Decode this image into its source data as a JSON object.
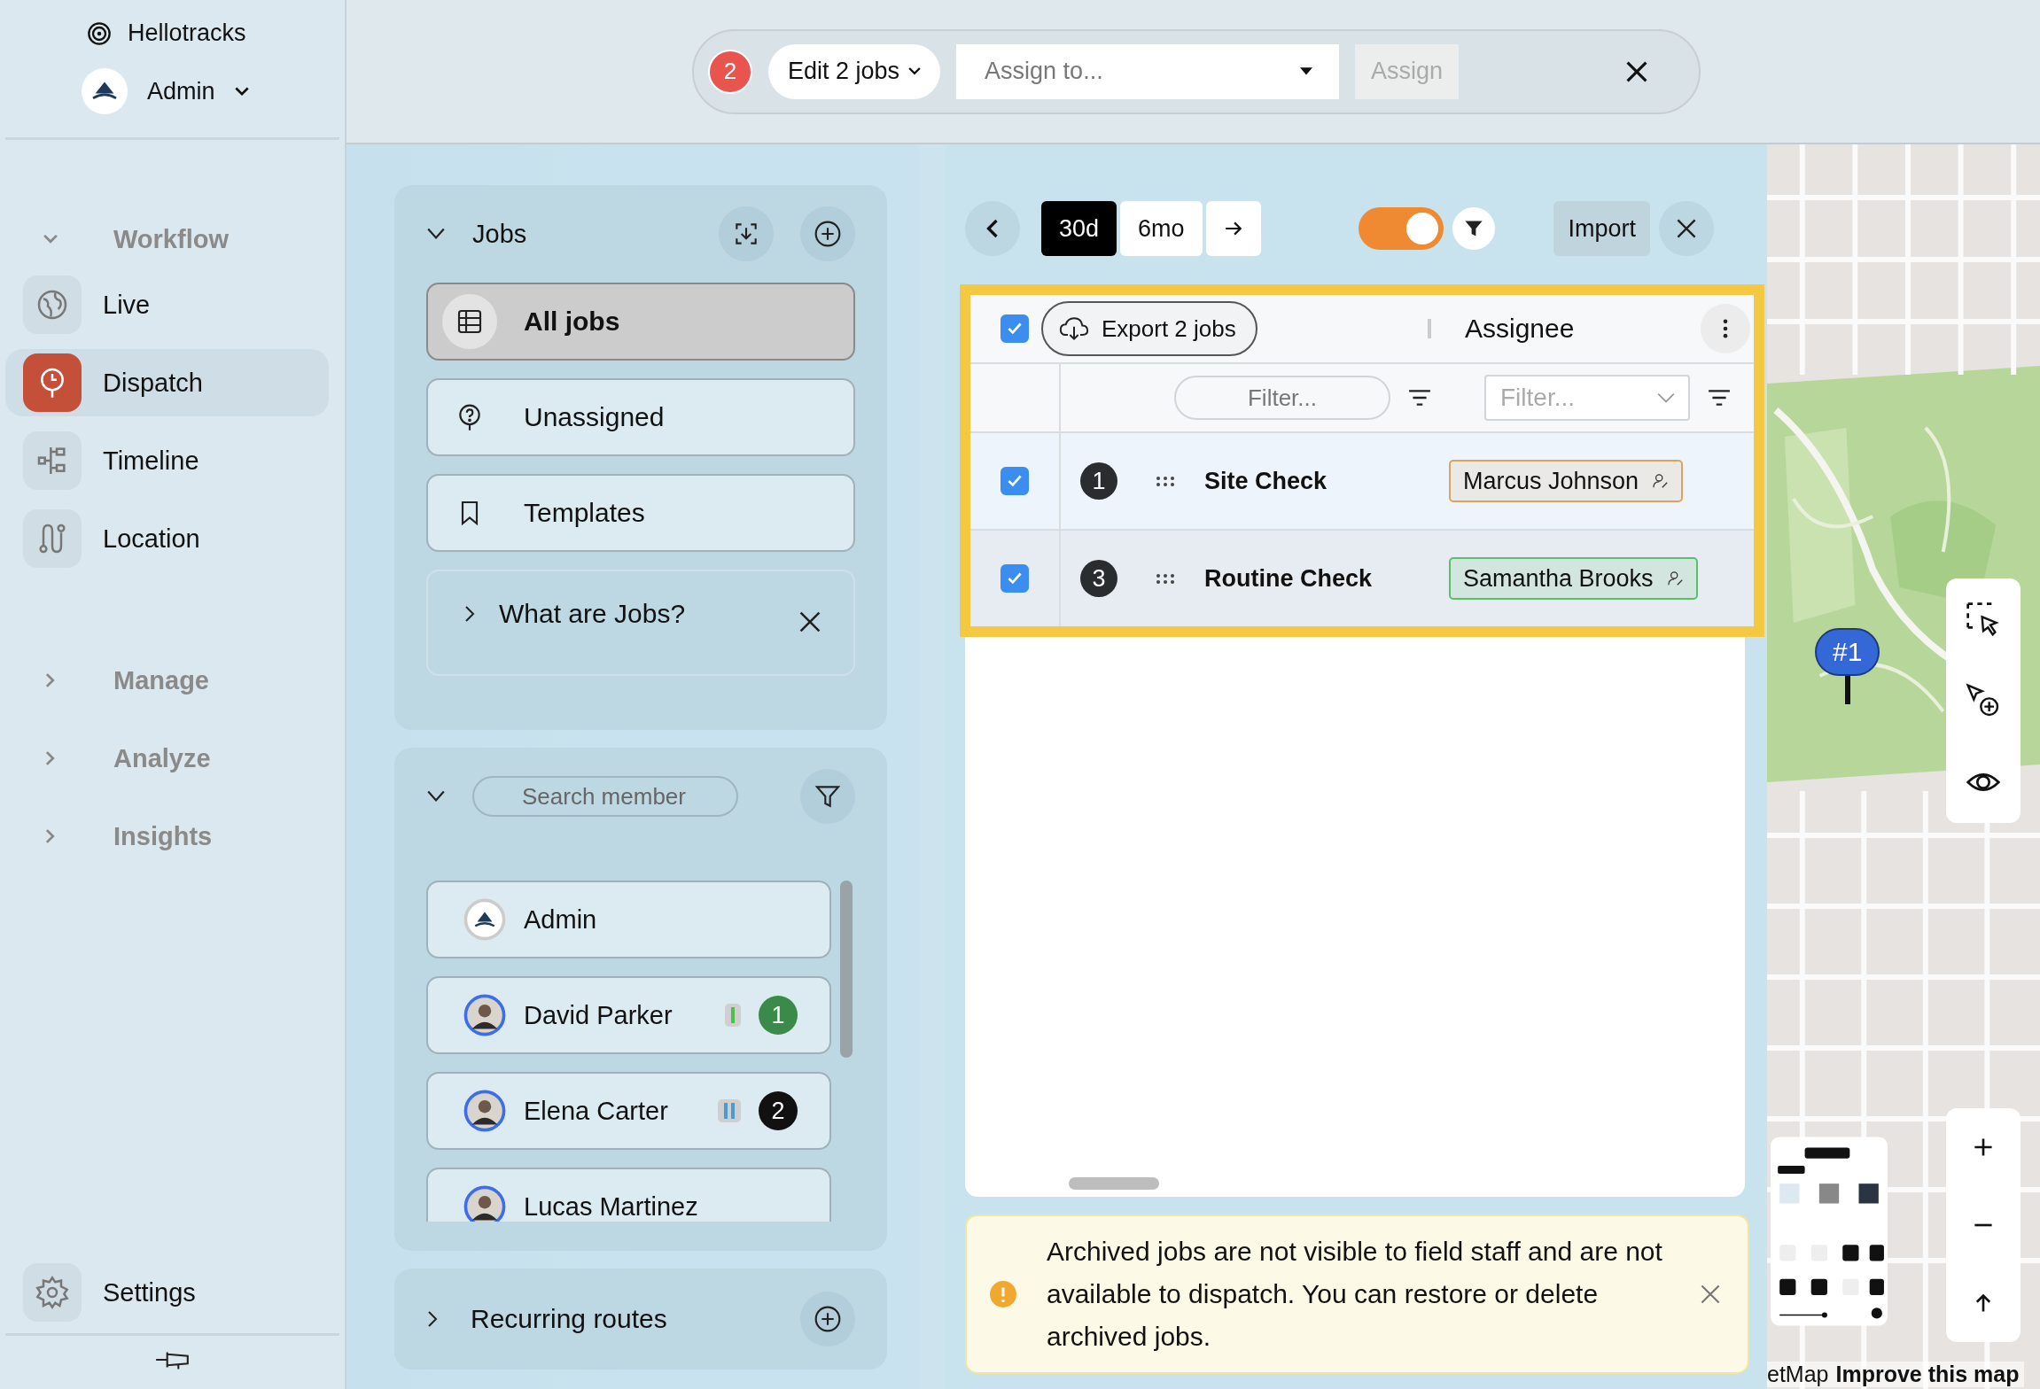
{
  "sidebar": {
    "brand": "Hellotracks",
    "account": "Admin",
    "groups": [
      {
        "label": "Workflow",
        "expanded": true,
        "items": [
          {
            "label": "Live",
            "selected": false
          },
          {
            "label": "Dispatch",
            "selected": true
          },
          {
            "label": "Timeline",
            "selected": false
          },
          {
            "label": "Location",
            "selected": false
          }
        ]
      },
      {
        "label": "Manage",
        "expanded": false
      },
      {
        "label": "Analyze",
        "expanded": false
      },
      {
        "label": "Insights",
        "expanded": false
      }
    ],
    "settings": "Settings"
  },
  "bulk_bar": {
    "count": "2",
    "edit_menu": "Edit 2 jobs",
    "assign_field": {
      "placeholder": "Assign to..."
    },
    "assign_button": {
      "label": "Assign",
      "disabled": true
    }
  },
  "jobs_panel": {
    "title": "Jobs",
    "expanded": true,
    "views": [
      {
        "label": "All jobs",
        "selected": true
      },
      {
        "label": "Unassigned",
        "selected": false
      },
      {
        "label": "Templates",
        "selected": false
      }
    ],
    "help": {
      "label": "What are Jobs?",
      "expanded": false
    }
  },
  "members_panel": {
    "expanded": true,
    "search": {
      "placeholder": "Search member"
    },
    "members": [
      {
        "name": "Admin",
        "kind": "company"
      },
      {
        "name": "David Parker",
        "kind": "person",
        "paused": false,
        "count": "1",
        "color": "#3a8a4a"
      },
      {
        "name": "Elena Carter",
        "kind": "person",
        "paused": true,
        "count": "2",
        "color": "#111111"
      },
      {
        "name": "Lucas Martinez",
        "kind": "person"
      }
    ]
  },
  "recurring_routes": {
    "label": "Recurring routes",
    "expanded": false
  },
  "range": {
    "options": [
      {
        "label": "30d",
        "selected": true
      },
      {
        "label": "6mo",
        "selected": false
      }
    ],
    "archive_toggle": {
      "on": true
    },
    "import": "Import"
  },
  "table": {
    "select_all": {
      "checked": true
    },
    "export": "Export 2 jobs",
    "column": "Assignee",
    "filters": [
      {
        "placeholder": "Filter..."
      },
      {
        "placeholder": "Filter..."
      }
    ],
    "rows": [
      {
        "checked": true,
        "number": "1",
        "title": "Site Check",
        "assignee": "Marcus Johnson",
        "color": "#d9a460"
      },
      {
        "checked": true,
        "number": "3",
        "title": "Routine Check",
        "assignee": "Samantha Brooks",
        "color": "#5bbf6a"
      }
    ]
  },
  "notice": {
    "text": "Archived jobs are not visible to field staff and are not available to dispatch. You can restore or delete archived jobs."
  },
  "map": {
    "marker": "#1",
    "attribution": [
      "etMap",
      "Improve this map"
    ]
  }
}
